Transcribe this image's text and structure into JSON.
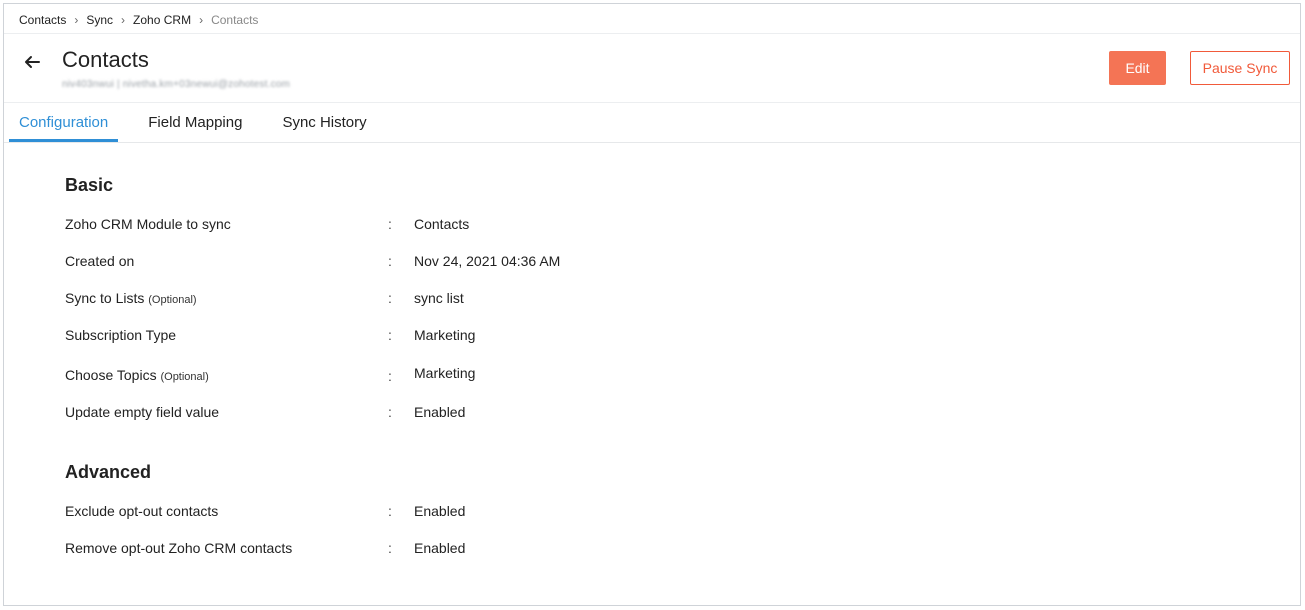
{
  "breadcrumb": {
    "items": [
      "Contacts",
      "Sync",
      "Zoho CRM"
    ],
    "current": "Contacts"
  },
  "header": {
    "title": "Contacts",
    "subtitle": "niv403nwui | nivetha.km+03newui@zohotest.com",
    "edit_label": "Edit",
    "pause_label": "Pause Sync"
  },
  "tabs": [
    {
      "label": "Configuration",
      "active": true
    },
    {
      "label": "Field Mapping",
      "active": false
    },
    {
      "label": "Sync History",
      "active": false
    }
  ],
  "basic": {
    "title": "Basic",
    "rows": [
      {
        "label": "Zoho CRM Module to sync",
        "optional": "",
        "value": "Contacts"
      },
      {
        "label": "Created on",
        "optional": "",
        "value": "Nov 24, 2021 04:36 AM"
      },
      {
        "label": "Sync to Lists",
        "optional": "(Optional)",
        "value": "sync list"
      },
      {
        "label": "Subscription Type",
        "optional": "",
        "value": "Marketing"
      },
      {
        "label": "Choose Topics",
        "optional": "(Optional)",
        "value": "Marketing"
      },
      {
        "label": "Update empty field value",
        "optional": "",
        "value": "Enabled"
      }
    ]
  },
  "advanced": {
    "title": "Advanced",
    "rows": [
      {
        "label": "Exclude opt-out contacts",
        "optional": "",
        "value": "Enabled"
      },
      {
        "label": "Remove opt-out Zoho CRM contacts",
        "optional": "",
        "value": "Enabled"
      }
    ]
  },
  "colon": ":",
  "colors": {
    "accent": "#2f8fd6",
    "primary_button": "#f47455",
    "pause_border": "#f15a3a"
  }
}
